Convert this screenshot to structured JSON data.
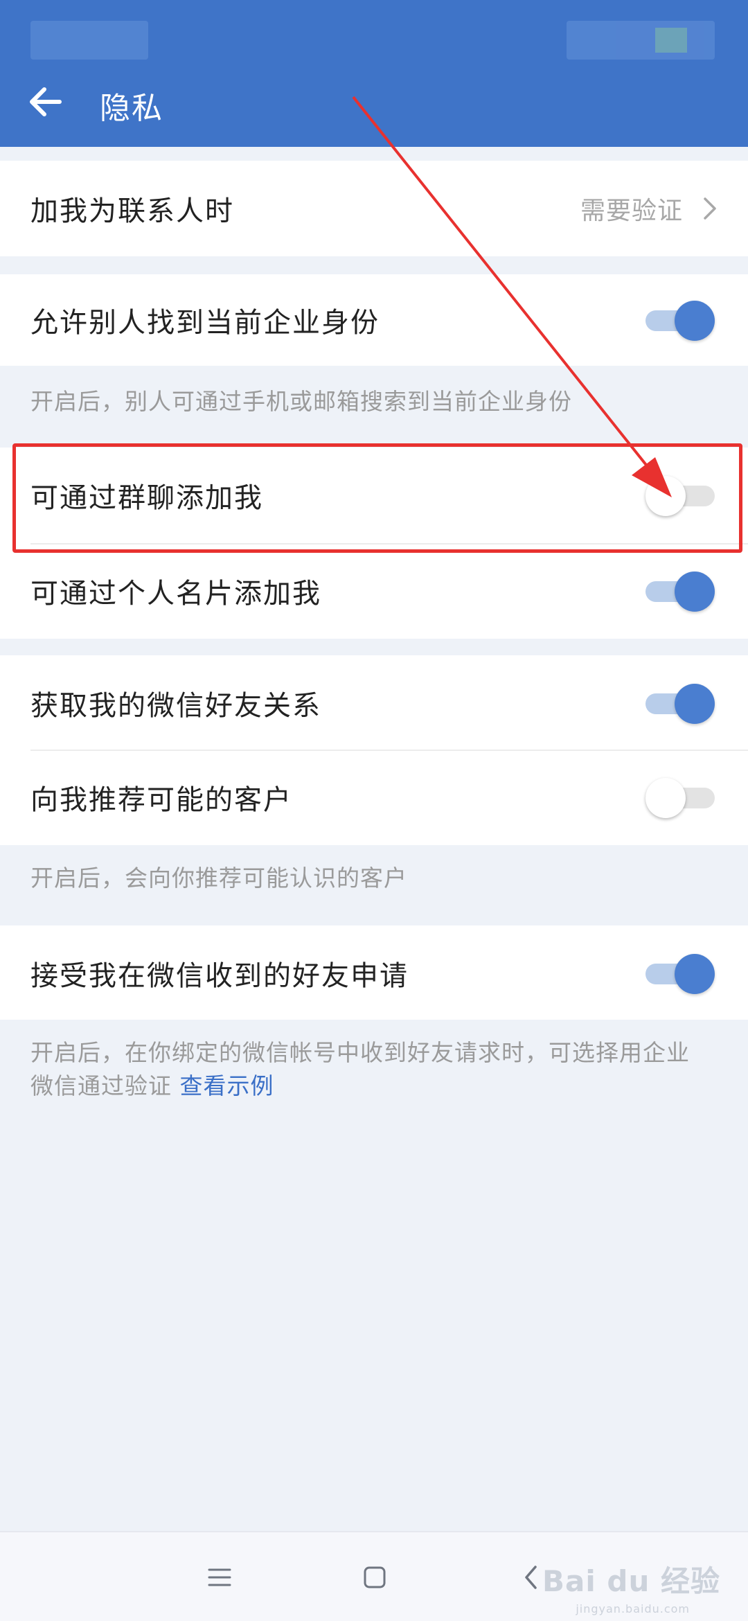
{
  "header": {
    "title": "隐私"
  },
  "rows": {
    "contact_verify": {
      "label": "加我为联系人时",
      "value": "需要验证"
    },
    "find_identity": {
      "label": "允许别人找到当前企业身份",
      "enabled": true
    },
    "group_chat": {
      "label": "可通过群聊添加我",
      "enabled": false
    },
    "card": {
      "label": "可通过个人名片添加我",
      "enabled": true
    },
    "wechat_friends": {
      "label": "获取我的微信好友关系",
      "enabled": true
    },
    "recommend": {
      "label": "向我推荐可能的客户",
      "enabled": false
    },
    "accept_requests": {
      "label": "接受我在微信收到的好友申请",
      "enabled": true
    }
  },
  "hints": {
    "find_identity": "开启后，别人可通过手机或邮箱搜索到当前企业身份",
    "recommend": "开启后，会向你推荐可能认识的客户",
    "accept_line1": "开启后，在你绑定的微信帐号中收到好友请求时，可选择用企业",
    "accept_line2": "微信通过验证",
    "accept_link": "查看示例"
  },
  "watermark": {
    "brand": "Bai du 经验",
    "url": "jingyan.baidu.com"
  },
  "icons": [
    "back-arrow-icon",
    "chevron-right-icon",
    "menu-icon",
    "home-icon",
    "back-icon"
  ],
  "colors": {
    "header": "#3f74c8",
    "toggle_on": "#4a7ed0",
    "annotation": "#e8312f",
    "link": "#3a6fc7"
  }
}
